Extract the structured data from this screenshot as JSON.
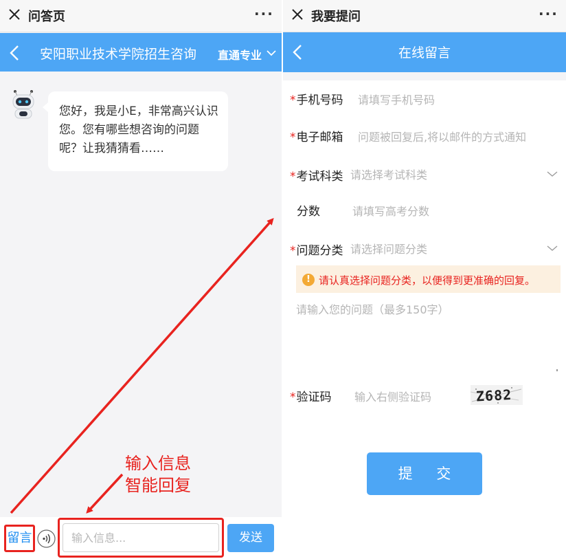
{
  "left": {
    "topbar": {
      "title": "问答页",
      "more": "···"
    },
    "header": {
      "title": "安阳职业技术学院招生咨询",
      "major_link": "直通专业"
    },
    "bot_message": "您好，我是小E，非常高兴认识您。您有哪些想咨询的问题呢？让我猜猜看……",
    "annotation": {
      "line1": "输入信息",
      "line2": "智能回复"
    },
    "bottom": {
      "leave_message": "留言",
      "input_placeholder": "输入信息...",
      "send": "发送"
    }
  },
  "right": {
    "topbar": {
      "title": "我要提问",
      "more": "···"
    },
    "header": {
      "title": "在线留言"
    },
    "form": {
      "required_mark": "*",
      "phone": {
        "label": "手机号码",
        "placeholder": "请填写手机号码"
      },
      "email": {
        "label": "电子邮箱",
        "placeholder": "问题被回复后,将以邮件的方式通知"
      },
      "exam_type": {
        "label": "考试科类",
        "placeholder": "请选择考试科类"
      },
      "score": {
        "label": "分数",
        "placeholder": "请填写高考分数"
      },
      "category": {
        "label": "问题分类",
        "placeholder": "请选择问题分类"
      },
      "tip": {
        "icon": "!",
        "text": "请认真选择问题分类，以便得到更准确的回复。"
      },
      "question": {
        "placeholder": "请输入您的问题（最多150字）"
      },
      "captcha": {
        "label": "验证码",
        "placeholder": "输入右侧验证码",
        "code": "Z682"
      },
      "submit": "提 交"
    }
  },
  "colors": {
    "primary_blue": "#4da6f5",
    "annotation_red": "#e8231f",
    "tip_bg": "#fcf0e0",
    "tip_icon": "#f3a935"
  }
}
